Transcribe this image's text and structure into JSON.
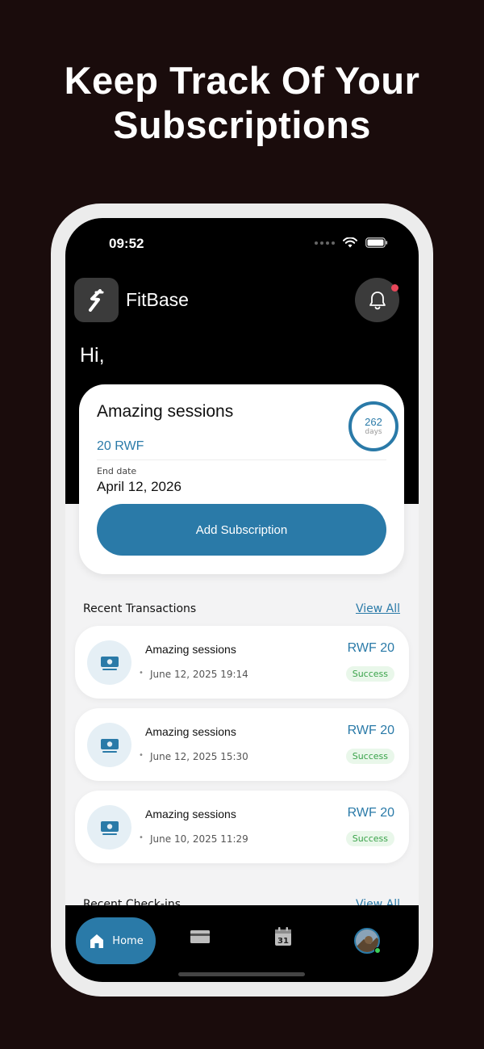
{
  "promo": {
    "headline_line1": "Keep Track Of Your",
    "headline_line2": "Subscriptions"
  },
  "status_bar": {
    "time": "09:52"
  },
  "header": {
    "brand": "FitBase",
    "greeting": "Hi,"
  },
  "subscription": {
    "title": "Amazing sessions",
    "price": "20 RWF",
    "days_remaining": "262",
    "days_label": "days",
    "end_date_label": "End date",
    "end_date": "April 12, 2026",
    "add_button_label": "Add Subscription"
  },
  "transactions": {
    "title": "Recent Transactions",
    "view_all": "View All",
    "items": [
      {
        "name": "Amazing sessions",
        "date": "June 12, 2025 19:14",
        "amount": "RWF 20",
        "status": "Success"
      },
      {
        "name": "Amazing sessions",
        "date": "June 12, 2025 15:30",
        "amount": "RWF 20",
        "status": "Success"
      },
      {
        "name": "Amazing sessions",
        "date": "June 10, 2025 11:29",
        "amount": "RWF 20",
        "status": "Success"
      }
    ]
  },
  "checkins": {
    "title": "Recent Check-ins",
    "view_all": "View All"
  },
  "tab_bar": {
    "home_label": "Home",
    "calendar_day": "31"
  },
  "colors": {
    "accent": "#2a7aa8",
    "background": "#1a0c0c",
    "success": "#3aa34a",
    "notification": "#e8475a"
  },
  "icons": [
    "fitbase-logo-icon",
    "bell-icon",
    "money-icon",
    "home-icon",
    "card-icon",
    "calendar-icon",
    "wifi-icon",
    "battery-icon"
  ]
}
